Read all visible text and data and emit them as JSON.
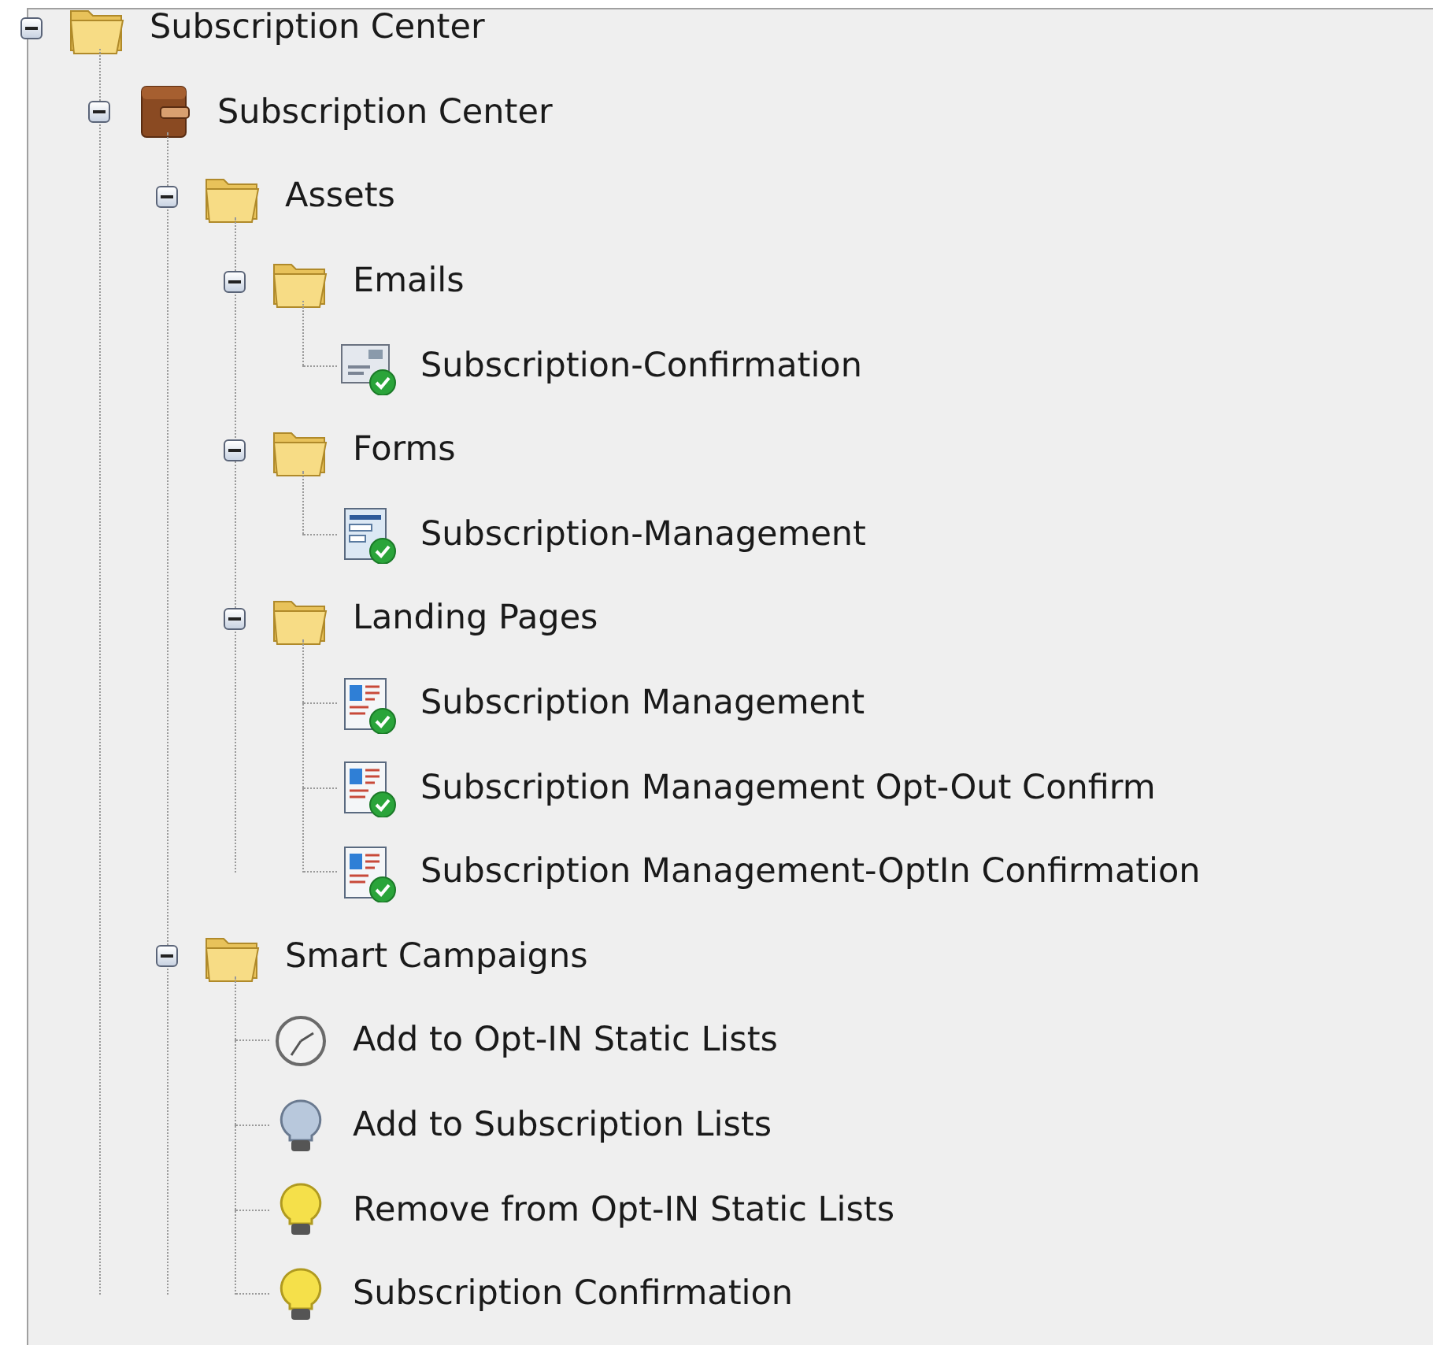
{
  "tree": [
    {
      "label": "Subscription Center",
      "kind": "folder",
      "expanded": true,
      "children": [
        {
          "label": "Subscription Center",
          "kind": "program",
          "expanded": true,
          "children": [
            {
              "label": "Assets",
              "kind": "folder",
              "expanded": true,
              "children": [
                {
                  "label": "Emails",
                  "kind": "folder",
                  "expanded": true,
                  "children": [
                    {
                      "label": "Subscription-Confirmation",
                      "kind": "email"
                    }
                  ]
                },
                {
                  "label": "Forms",
                  "kind": "folder",
                  "expanded": true,
                  "children": [
                    {
                      "label": "Subscription-Management",
                      "kind": "form"
                    }
                  ]
                },
                {
                  "label": "Landing Pages",
                  "kind": "folder",
                  "expanded": true,
                  "children": [
                    {
                      "label": "Subscription Management",
                      "kind": "landing_page"
                    },
                    {
                      "label": "Subscription Management Opt-Out Confirm",
                      "kind": "landing_page"
                    },
                    {
                      "label": "Subscription Management-OptIn Confirmation",
                      "kind": "landing_page"
                    }
                  ]
                }
              ]
            },
            {
              "label": "Smart Campaigns",
              "kind": "folder",
              "expanded": true,
              "children": [
                {
                  "label": "Add to Opt-IN Static Lists",
                  "kind": "batch_campaign"
                },
                {
                  "label": "Add to Subscription Lists",
                  "kind": "trigger_campaign",
                  "active": false
                },
                {
                  "label": "Remove from Opt-IN Static Lists",
                  "kind": "trigger_campaign",
                  "active": true
                },
                {
                  "label": "Subscription Confirmation",
                  "kind": "trigger_campaign",
                  "active": true
                }
              ]
            }
          ]
        }
      ]
    }
  ]
}
